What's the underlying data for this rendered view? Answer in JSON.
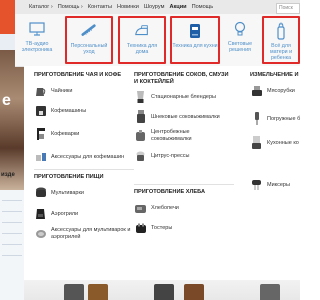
{
  "topnav": {
    "items": [
      {
        "label": "Каталог ›"
      },
      {
        "label": "Помощь ›"
      },
      {
        "label": "Контакты"
      },
      {
        "label": "Новинки"
      },
      {
        "label": "Шоурум"
      },
      {
        "label": "Акции"
      },
      {
        "label": "Помощь"
      }
    ],
    "search_placeholder": "Поиск"
  },
  "background": {
    "photo_letter": "е",
    "sidebar_title": "изде"
  },
  "categories": [
    {
      "label": "ТВ-аудио электроника",
      "icon": "tv-icon",
      "highlighted": false
    },
    {
      "label": "Персональный уход",
      "icon": "comb-icon",
      "highlighted": true
    },
    {
      "label": "Техника для дома",
      "icon": "iron-icon",
      "highlighted": true
    },
    {
      "label": "Техника для кухни",
      "icon": "kettle-icon",
      "highlighted": true
    },
    {
      "label": "Световые решения",
      "icon": "lightbulb-icon",
      "highlighted": false
    },
    {
      "label": "Всё для матери и ребенка",
      "icon": "baby-bottle-icon",
      "highlighted": true
    }
  ],
  "columns": {
    "tea": {
      "title": "ПРИГОТОВЛЕНИЕ ЧАЯ И КОФЕ",
      "items": [
        "Чайники",
        "Кофемашины",
        "Кофеварки",
        "Аксессуары для кофемашин"
      ]
    },
    "food": {
      "title": "ПРИГОТОВЛЕНИЕ ПИЩИ",
      "items": [
        "Мультиварки",
        "Аэрогрили",
        "Аксессуары для мультиварок и аэрогрилей"
      ]
    },
    "juice": {
      "title": "ПРИГОТОВЛЕНИЕ СОКОВ, СМУЗИ И КОКТЕЙЛЕЙ",
      "items": [
        "Стационарные блендеры",
        "Шнековые соковыжималки",
        "Центробежные соковыжималки",
        "Цитрус-прессы"
      ]
    },
    "bread": {
      "title": "ПРИГОТОВЛЕНИЕ ХЛЕБА",
      "items": [
        "Хлебопечи",
        "Тостеры"
      ]
    },
    "grind": {
      "title": "ИЗМЕЛЬЧЕНИЕ И СМ",
      "items": [
        "Мясорубки",
        "Погружные б",
        "Кухонные ко",
        "Миксеры"
      ]
    }
  },
  "colors": {
    "accent_link": "#4f8fc9",
    "highlight_border": "#e02a2a",
    "brand_orange": "#e5532d"
  }
}
